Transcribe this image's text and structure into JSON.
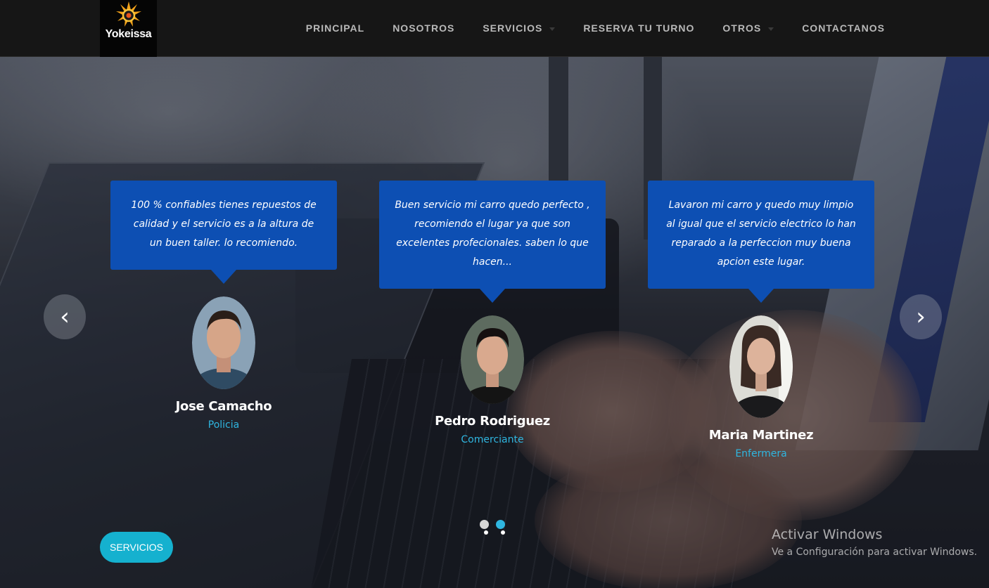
{
  "brand": {
    "name": "Yokeissa",
    "accent": "#0d4fb3",
    "highlight": "#2fb6e0",
    "cta_color": "#15b1cf"
  },
  "nav": {
    "items": [
      {
        "label": "PRINCIPAL",
        "dropdown": false
      },
      {
        "label": "NOSOTROS",
        "dropdown": false
      },
      {
        "label": "SERVICIOS",
        "dropdown": true
      },
      {
        "label": "RESERVA TU TURNO",
        "dropdown": false
      },
      {
        "label": "OTROS",
        "dropdown": true
      },
      {
        "label": "CONTACTANOS",
        "dropdown": false
      }
    ]
  },
  "testimonials": [
    {
      "quote": "100 % confiables tienes repuestos de calidad y el servicio es a la altura de un buen taller. lo recomiendo.",
      "name": "Jose Camacho",
      "role": "Policia"
    },
    {
      "quote": "Buen servicio mi carro quedo perfecto , recomiendo el lugar ya que son excelentes profecionales. saben lo que hacen...",
      "name": "Pedro Rodriguez",
      "role": "Comerciante"
    },
    {
      "quote": "Lavaron mi carro y quedo muy limpio al igual que el servicio electrico lo han reparado a la perfeccion muy buena apcion este lugar.",
      "name": "Maria Martinez",
      "role": "Enfermera"
    }
  ],
  "carousel": {
    "prev_symbol": "‹",
    "next_symbol": "›",
    "total_slides": 2,
    "active_slide": 2
  },
  "cta": {
    "label": "SERVICIOS"
  },
  "watermark": {
    "title": "Activar Windows",
    "subtitle": "Ve a Configuración para activar Windows."
  }
}
